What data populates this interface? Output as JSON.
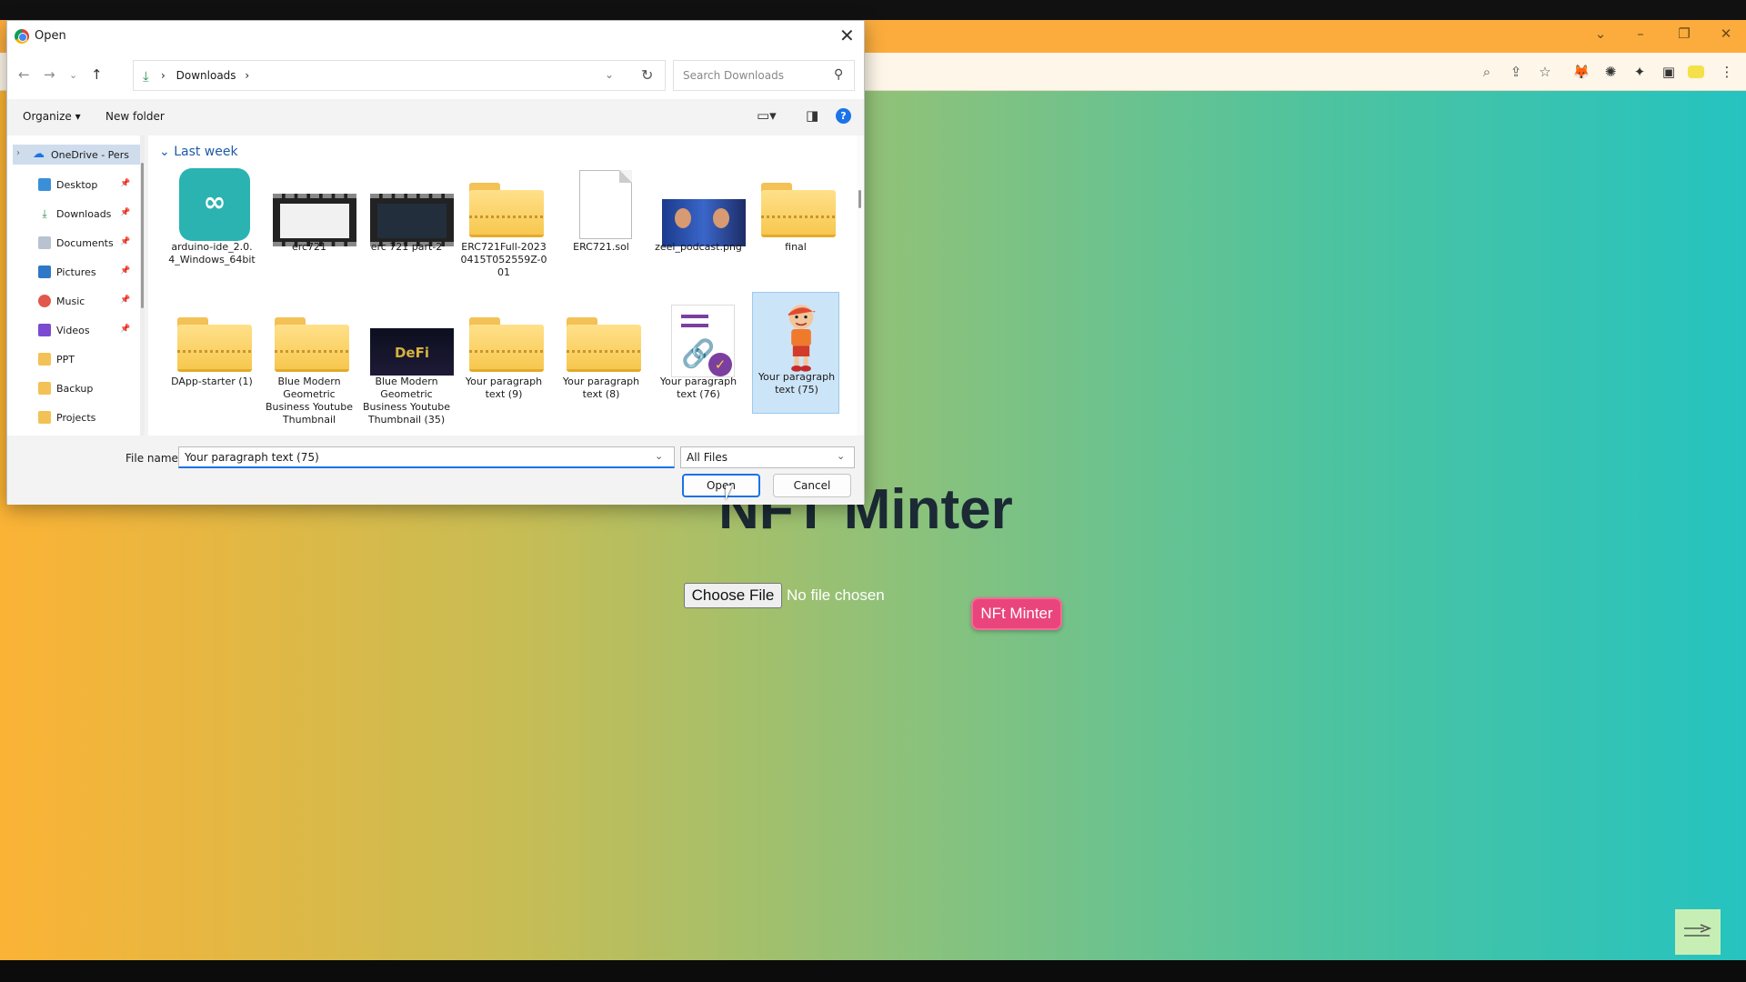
{
  "browser": {
    "window_controls": [
      "⌄",
      "–",
      "❐",
      "✕"
    ],
    "toolbar_icons": [
      "zoom-icon",
      "share-icon",
      "star-icon",
      "metamask-icon",
      "extension-icon",
      "puzzle-icon",
      "sidepanel-icon",
      "profile-icon",
      "menu-icon"
    ]
  },
  "page": {
    "title": "NFT Minter",
    "choose_file_label": "Choose File",
    "no_file_text": "No file chosen",
    "mint_button_label": "NFt Minter",
    "gradient_colors": [
      "#fbb335",
      "#c6bd55",
      "#84c280",
      "#4fc39e",
      "#25c3c0"
    ]
  },
  "dialog": {
    "title": "Open",
    "breadcrumb": "Downloads",
    "breadcrumb_sep": "›",
    "search_placeholder": "Search Downloads",
    "organize_label": "Organize ▾",
    "new_folder_label": "New folder",
    "nav": {
      "onedrive": "OneDrive - Pers",
      "items": [
        {
          "label": "Desktop",
          "icon": "desktop-icon",
          "pinned": true
        },
        {
          "label": "Downloads",
          "icon": "downloads-icon",
          "pinned": true
        },
        {
          "label": "Documents",
          "icon": "documents-icon",
          "pinned": true
        },
        {
          "label": "Pictures",
          "icon": "pictures-icon",
          "pinned": true
        },
        {
          "label": "Music",
          "icon": "music-icon",
          "pinned": true
        },
        {
          "label": "Videos",
          "icon": "videos-icon",
          "pinned": true
        },
        {
          "label": "PPT",
          "icon": "folder-icon",
          "pinned": false
        },
        {
          "label": "Backup",
          "icon": "folder-icon",
          "pinned": false
        },
        {
          "label": "Projects",
          "icon": "folder-icon",
          "pinned": false
        }
      ]
    },
    "group_header": "Last week",
    "files": [
      {
        "name": "arduino-ide_2.0.4_Windows_64bit",
        "kind": "arduino"
      },
      {
        "name": "erc721",
        "kind": "video-light"
      },
      {
        "name": "erc 721 part-2",
        "kind": "video-dark"
      },
      {
        "name": "ERC721Full-20230415T052559Z-001",
        "kind": "zip-folder"
      },
      {
        "name": "ERC721.sol",
        "kind": "document"
      },
      {
        "name": "zeel_podcast.png",
        "kind": "photo"
      },
      {
        "name": "final",
        "kind": "zip-folder"
      },
      {
        "name": "DApp-starter (1)",
        "kind": "zip-folder"
      },
      {
        "name": "Blue Modern Geometric Business Youtube Thumbnail",
        "kind": "zip-folder"
      },
      {
        "name": "Blue Modern Geometric Business Youtube Thumbnail (35)",
        "kind": "defi"
      },
      {
        "name": "Your paragraph text (9)",
        "kind": "zip-folder"
      },
      {
        "name": "Your paragraph text (8)",
        "kind": "zip-folder"
      },
      {
        "name": "Your paragraph text (76)",
        "kind": "link-doc"
      },
      {
        "name": "Your paragraph text (75)",
        "kind": "cartoon",
        "selected": true
      }
    ],
    "defi_text": "DeFi",
    "file_name_label": "File name:",
    "file_name_value": "Your paragraph text (75)",
    "file_type_value": "All Files",
    "open_label": "Open",
    "cancel_label": "Cancel"
  }
}
